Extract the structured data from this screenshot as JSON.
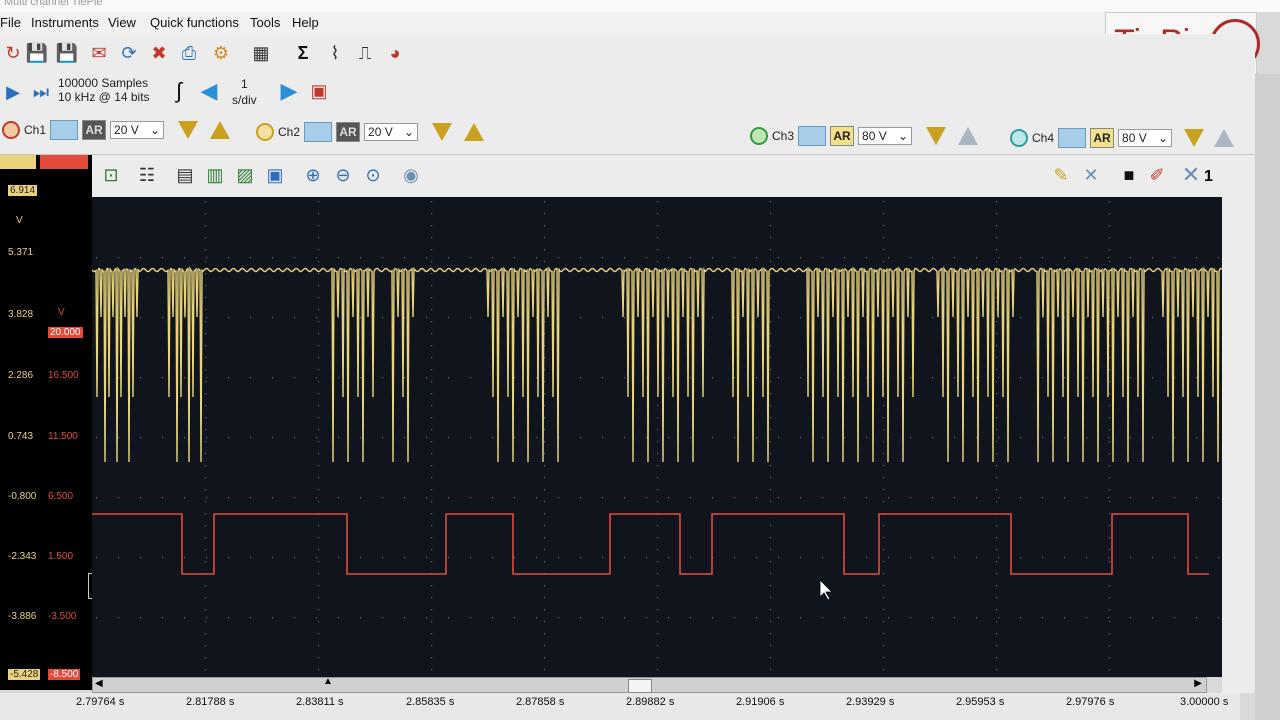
{
  "window": {
    "title": "Multi channel TiePie"
  },
  "menu": [
    "File",
    "Instruments",
    "View",
    "Quick functions",
    "Tools",
    "Help"
  ],
  "logo": {
    "text": "TiePie"
  },
  "acquisition": {
    "samples": "100000 Samples",
    "rate": "10 kHz @ 14 bits",
    "timebase_value": "1",
    "timebase_unit": "s/div"
  },
  "channels": [
    {
      "label": "Ch1",
      "range": "20 V",
      "ar": "AR",
      "color": "#c0392b"
    },
    {
      "label": "Ch2",
      "range": "20 V",
      "ar": "AR",
      "color": "#c9a11e"
    },
    {
      "label": "Ch3",
      "range": "80 V",
      "ar": "AR",
      "color": "#2e9c3a"
    },
    {
      "label": "Ch4",
      "range": "80 V",
      "ar": "AR",
      "color": "#2e9c9c"
    }
  ],
  "scope_toolbar": {
    "close_count": "1"
  },
  "y_axis_ch1": [
    "6.914",
    "5.371",
    "3.828",
    "2.286",
    "0.743",
    "-0.800",
    "-2.343",
    "-3.886",
    "-5.428"
  ],
  "y_axis_ch1_unit": "V",
  "y_axis_ch2": [
    "20.000",
    "16.500",
    "11.500",
    "6.500",
    "1.500",
    "-3.500",
    "-8.500"
  ],
  "y_axis_ch2_unit": "V",
  "time_axis": [
    "2.79764 s",
    "2.81788 s",
    "2.83811 s",
    "2.85835 s",
    "2.87858 s",
    "2.89882 s",
    "2.91906 s",
    "2.93929 s",
    "2.95953 s",
    "2.97976 s",
    "3.00000 s"
  ],
  "colors": {
    "trace_yellow": "#e8d37a",
    "trace_red": "#e34a3a",
    "plot_bg": "#10141d"
  }
}
